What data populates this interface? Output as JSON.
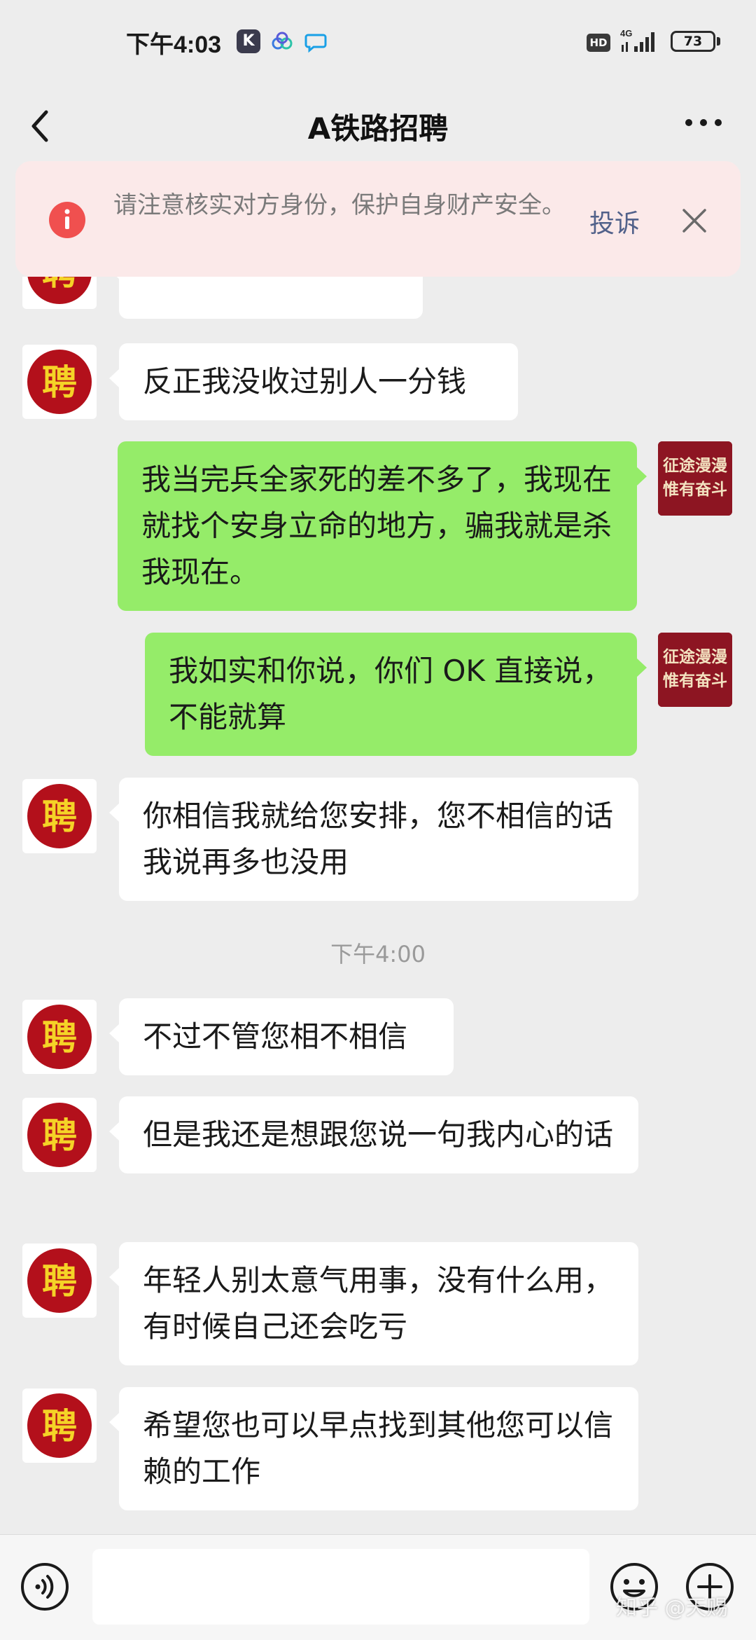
{
  "status_bar": {
    "time": "下午4:03",
    "app_icon_k": "K",
    "hd_label": "HD",
    "network": "4G",
    "battery": "73"
  },
  "nav": {
    "title": "A铁路招聘",
    "back_icon": "chevron-left-icon",
    "more_icon": "more-horizontal-icon"
  },
  "warning": {
    "text": "请注意核实对方身份，保护自身财产安全。",
    "report_label": "投诉",
    "close_icon": "close-icon"
  },
  "avatars": {
    "contact_char": "聘",
    "self_line1": "征途漫漫",
    "self_line2": "惟有奋斗"
  },
  "messages": [
    {
      "from": "contact",
      "text": "反正我没收过别人一分钱"
    },
    {
      "from": "me",
      "text": "我当完兵全家死的差不多了，我现在就找个安身立命的地方，骗我就是杀我现在。"
    },
    {
      "from": "me",
      "text": "我如实和你说，你们 OK 直接说，不能就算"
    },
    {
      "from": "contact",
      "text": "你相信我就给您安排，您不相信的话我说再多也没用"
    },
    {
      "from": "contact",
      "text": "不过不管您相不相信"
    },
    {
      "from": "contact",
      "text": "但是我还是想跟您说一句我内心的话"
    },
    {
      "from": "contact",
      "text": "年轻人别太意气用事，没有什么用，有时候自己还会吃亏"
    },
    {
      "from": "contact",
      "text": "希望您也可以早点找到其他您可以信赖的工作"
    }
  ],
  "timestamp": "下午4:00",
  "input_bar": {
    "voice_icon": "voice-icon",
    "emoji_icon": "emoji-icon",
    "plus_icon": "plus-icon"
  },
  "watermark": "知乎 @天赐"
}
